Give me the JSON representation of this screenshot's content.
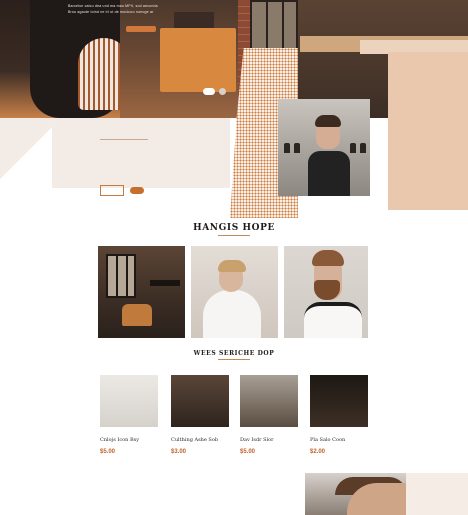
{
  "hero": {
    "lines": [
      "Barcelon calcu dea und ma mau MPII, sod aeconda",
      "Brou agaute tolnd ne lrl ot de muiduco noeoge ar"
    ],
    "cta_label": ""
  },
  "about": {
    "title": "",
    "lines": [
      "",
      "",
      "",
      "",
      ""
    ]
  },
  "gallery": {
    "title": "HANGIS HOPE"
  },
  "services": {
    "title": "WEES SERICHE DOP",
    "items": [
      {
        "name": "Cnlojs Icon Bsy",
        "price": "$5.00"
      },
      {
        "name": "Culthing Ashe Sob",
        "price": "$3.00"
      },
      {
        "name": "Dav Isdr Slor",
        "price": "$5.00"
      },
      {
        "name": "Pla Salo Coon",
        "price": "$2.00"
      }
    ]
  },
  "colors": {
    "accent": "#c7702e",
    "dark": "#1f1b19",
    "beige": "#f3ece6"
  }
}
